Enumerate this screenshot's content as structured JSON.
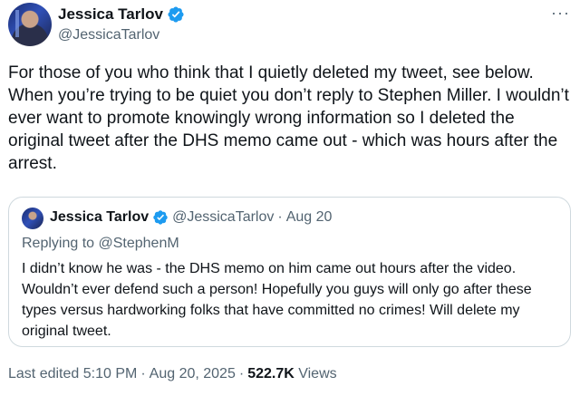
{
  "author": {
    "name": "Jessica Tarlov",
    "handle": "@JessicaTarlov",
    "avatar_icon": "profile-photo",
    "verified_icon": "verified-badge-icon"
  },
  "more_menu": {
    "label": "···",
    "icon": "more-icon"
  },
  "tweet": {
    "text": "For those of you who think that I quietly deleted my tweet, see below. When you’re trying to be quiet you don’t reply to Stephen Miller. I wouldn’t ever want to promote knowingly wrong information so I deleted the original tweet after the DHS memo came out - which was hours after the arrest."
  },
  "quoted": {
    "name": "Jessica Tarlov",
    "handle": "@JessicaTarlov",
    "separator": "·",
    "date": "Aug 20",
    "replying_to_prefix": "Replying to ",
    "replying_to_handle": "@StephenM",
    "text": "I didn’t know he was - the DHS memo on him came out hours after the video. Wouldn’t ever defend such a person! Hopefully you guys will only go after these types versus hardworking folks that have committed no crimes! Will delete my original tweet."
  },
  "footer": {
    "edited_prefix": "Last edited ",
    "time": "5:10 PM",
    "separator": "·",
    "date": "Aug 20, 2025",
    "views_count": "522.7K",
    "views_label": "Views"
  },
  "colors": {
    "verified_blue": "#1d9bf0",
    "text_primary": "#0f1419",
    "text_secondary": "#536471",
    "border": "#cfd9de"
  }
}
